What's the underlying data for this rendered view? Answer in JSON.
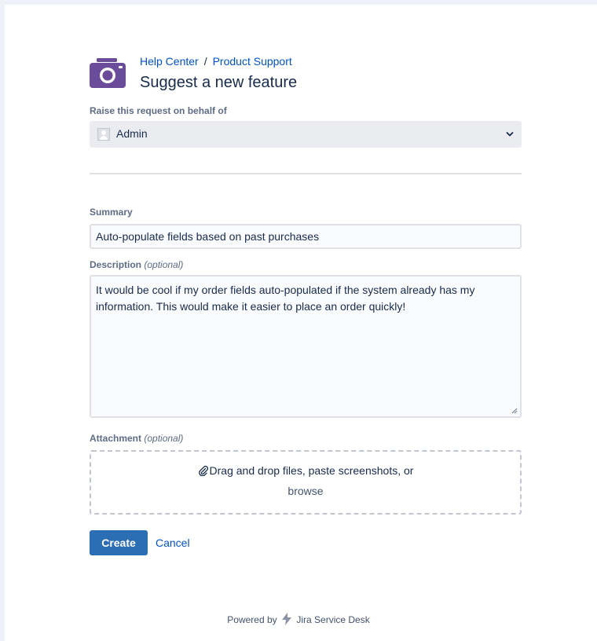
{
  "breadcrumb": {
    "help_center": "Help Center",
    "separator": "/",
    "project": "Product Support"
  },
  "page_title": "Suggest a new feature",
  "behalf": {
    "label": "Raise this request on behalf of",
    "selected_user": "Admin",
    "avatar_icon": "user-avatar-icon",
    "dropdown_icon": "chevron-down-icon"
  },
  "summary": {
    "label": "Summary",
    "value": "Auto-populate fields based on past purchases"
  },
  "description": {
    "label": "Description",
    "optional": "(optional)",
    "value": "It would be cool if my order fields auto-populated if the system already has my information. This would make it easier to place an order quickly!"
  },
  "attachment": {
    "label": "Attachment",
    "optional": "(optional)",
    "drop_text": "Drag and drop files, paste screenshots, or",
    "browse": "browse",
    "icon": "paperclip-icon"
  },
  "actions": {
    "create": "Create",
    "cancel": "Cancel"
  },
  "footer": {
    "powered_by": "Powered by",
    "product": "Jira Service Desk"
  },
  "colors": {
    "page_bg": "#eef1f8",
    "link": "#0052cc",
    "primary_button": "#2c6eb4",
    "logo": "#6b4c9a"
  }
}
